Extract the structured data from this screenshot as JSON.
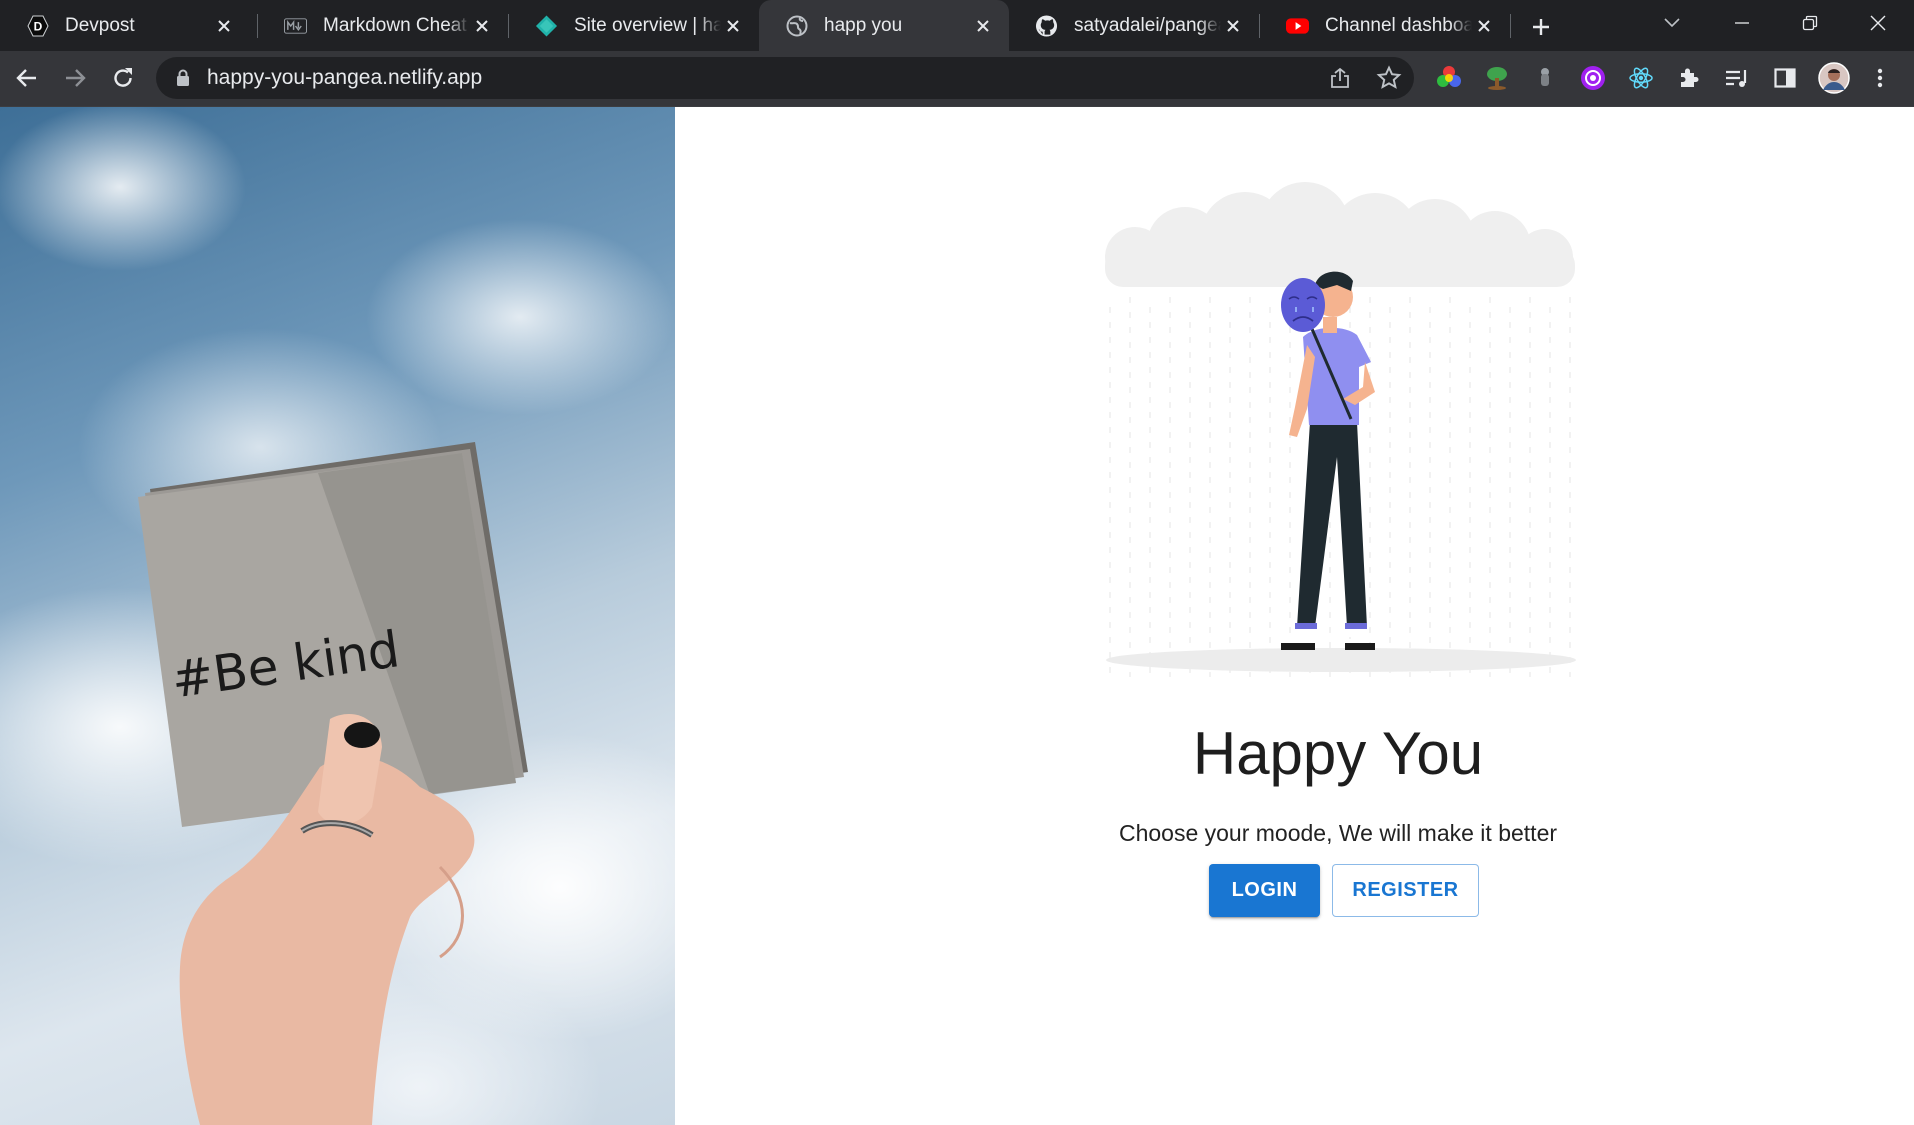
{
  "browser": {
    "tabs": [
      {
        "title": "Devpost",
        "icon": "devpost-icon"
      },
      {
        "title": "Markdown Cheat Sheet",
        "icon": "markdown-icon"
      },
      {
        "title": "Site overview | happy-you-pangea",
        "icon": "netlify-icon"
      },
      {
        "title": "happ you",
        "icon": "globe-icon",
        "active": true
      },
      {
        "title": "satyadalei/pangea-happy-you",
        "icon": "github-icon"
      },
      {
        "title": "Channel dashboard",
        "icon": "youtube-icon"
      }
    ],
    "address_bar": {
      "url": "happy-you-pangea.netlify.app"
    },
    "extensions": [
      "color-picker-icon",
      "tree-icon",
      "lamp-icon",
      "purple-extension-icon",
      "react-devtools-icon",
      "puzzle-icon"
    ]
  },
  "page": {
    "photo_text": "#Be kind",
    "title": "Happy You",
    "tagline": "Choose your moode, We will make it better",
    "login_label": "LOGIN",
    "register_label": "REGISTER"
  },
  "colors": {
    "primary": "#1976d2",
    "tabstrip": "#202124",
    "toolbar": "#35363a",
    "illustration_accent": "#7f7fe8"
  }
}
